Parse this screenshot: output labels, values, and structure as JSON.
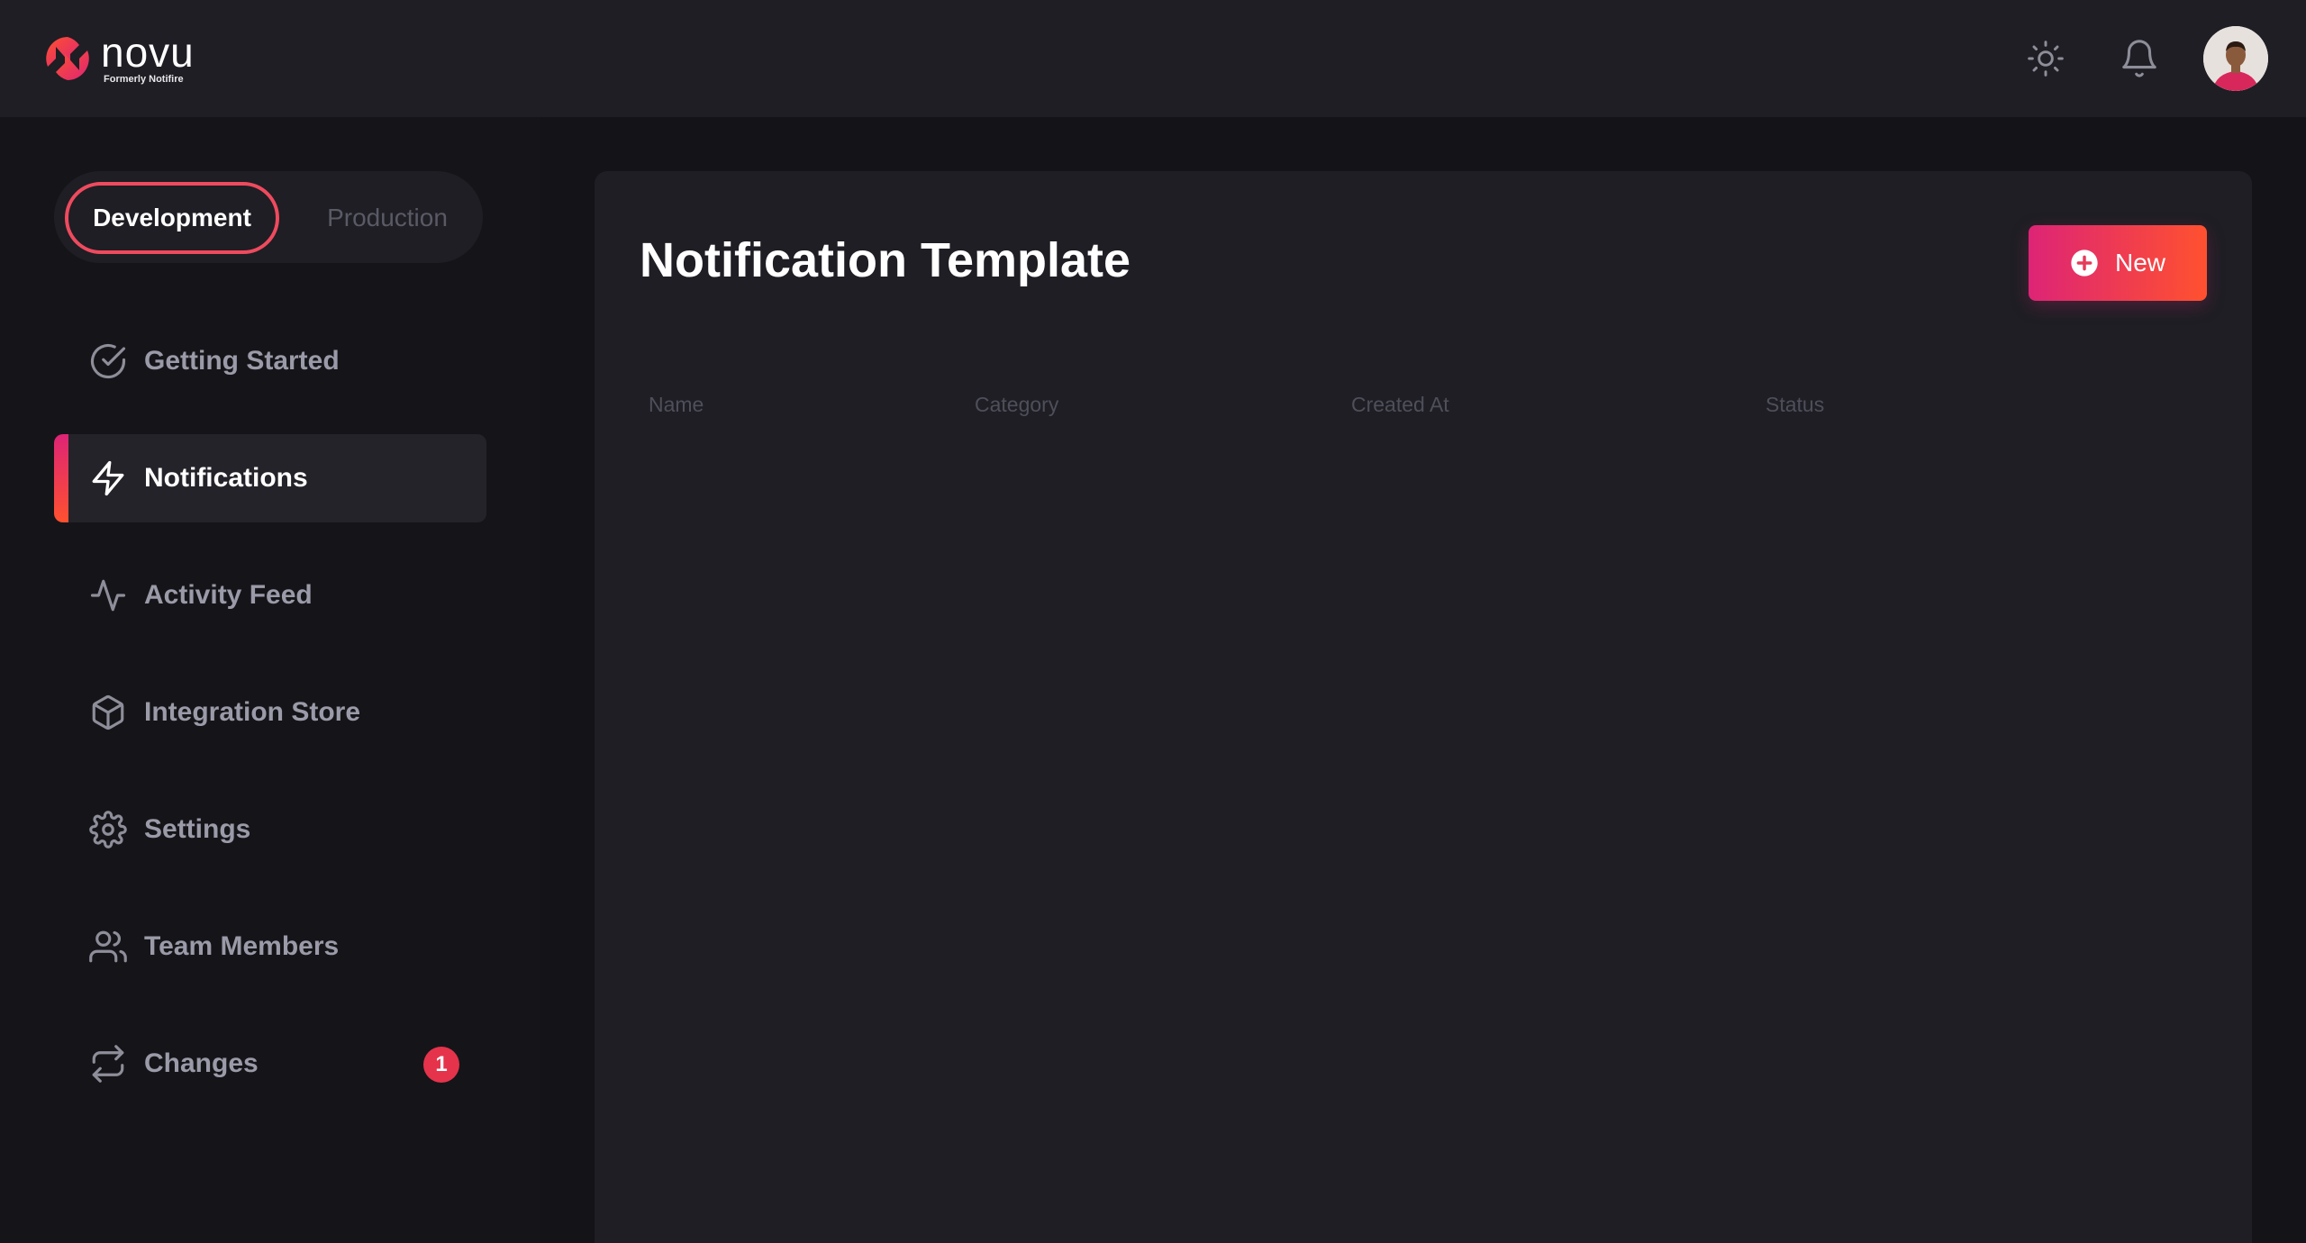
{
  "brand": {
    "name": "novu",
    "tagline": "Formerly Notifire",
    "accent_gradient": [
      "#dd2476",
      "#ff512f"
    ]
  },
  "header": {
    "icons": [
      "sun-icon",
      "bell-icon",
      "avatar"
    ]
  },
  "environment": {
    "options": [
      "Development",
      "Production"
    ],
    "selected": "Development"
  },
  "sidebar": {
    "items": [
      {
        "label": "Getting Started",
        "icon": "check-circle-icon",
        "active": false
      },
      {
        "label": "Notifications",
        "icon": "lightning-icon",
        "active": true
      },
      {
        "label": "Activity Feed",
        "icon": "activity-icon",
        "active": false
      },
      {
        "label": "Integration Store",
        "icon": "box-icon",
        "active": false
      },
      {
        "label": "Settings",
        "icon": "gear-icon",
        "active": false
      },
      {
        "label": "Team Members",
        "icon": "users-icon",
        "active": false
      },
      {
        "label": "Changes",
        "icon": "repeat-icon",
        "active": false,
        "badge": "1"
      }
    ]
  },
  "main": {
    "title": "Notification Template",
    "new_button_label": "New",
    "table": {
      "columns": [
        "Name",
        "Category",
        "Created At",
        "Status"
      ],
      "rows": []
    }
  }
}
